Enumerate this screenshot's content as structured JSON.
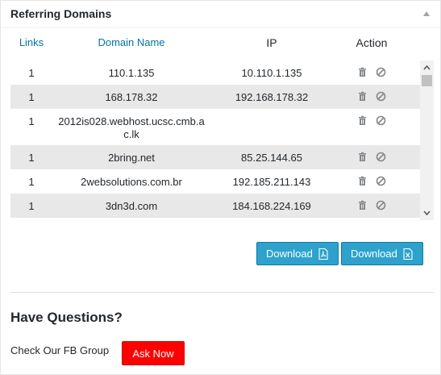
{
  "panel": {
    "title": "Referring Domains"
  },
  "table": {
    "headers": {
      "links": "Links",
      "domain": "Domain Name",
      "ip": "IP",
      "action": "Action"
    },
    "rows": [
      {
        "links": "1",
        "domain": "110.1.135",
        "ip": "10.110.1.135"
      },
      {
        "links": "1",
        "domain": "168.178.32",
        "ip": "192.168.178.32"
      },
      {
        "links": "1",
        "domain": "2012is028.webhost.ucsc.cmb.ac.lk",
        "ip": ""
      },
      {
        "links": "1",
        "domain": "2bring.net",
        "ip": "85.25.144.65"
      },
      {
        "links": "1",
        "domain": "2websolutions.com.br",
        "ip": "192.185.211.143"
      },
      {
        "links": "1",
        "domain": "3dn3d.com",
        "ip": "184.168.224.169"
      }
    ]
  },
  "buttons": {
    "download_pdf": "Download",
    "download_xls": "Download"
  },
  "questions": {
    "title": "Have Questions?",
    "text": "Check Our FB Group",
    "ask_button": "Ask Now"
  },
  "colors": {
    "link_blue": "#0073aa",
    "button_blue": "#2ea2cc",
    "ask_red": "#ff0000",
    "row_alt": "#e8e8e8"
  },
  "icons": [
    "trash-icon",
    "block-icon",
    "pdf-file-icon",
    "excel-file-icon",
    "collapse-arrow-icon"
  ]
}
